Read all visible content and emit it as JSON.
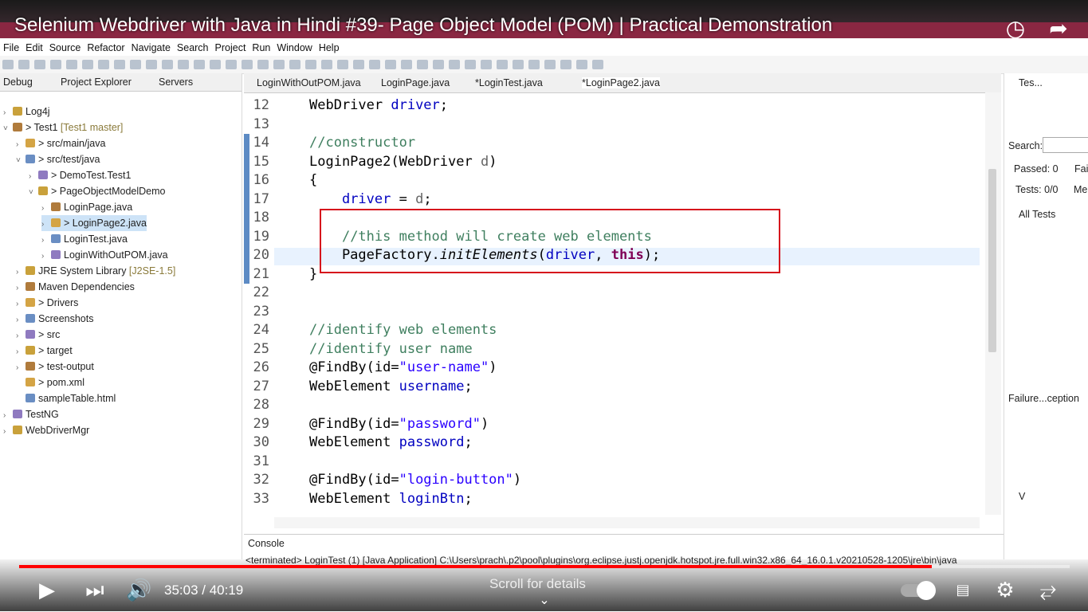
{
  "video": {
    "title": "Selenium Webdriver with Java in Hindi #39- Page Object Model (POM) | Practical Demonstration",
    "time": "35:03 / 40:19",
    "progress": 0.869,
    "scroll_hint": "Scroll for details"
  },
  "menu": [
    "File",
    "Edit",
    "Source",
    "Refactor",
    "Navigate",
    "Search",
    "Project",
    "Run",
    "Window",
    "Help"
  ],
  "left_tabs": {
    "debug": "Debug",
    "project_explorer": "Project Explorer",
    "servers": "Servers"
  },
  "tree": [
    {
      "label": "Log4j",
      "deco": "",
      "indent": 0,
      "arrow": ">"
    },
    {
      "label": "> Test1",
      "deco": "[Test1 master]",
      "indent": 0,
      "arrow": "v"
    },
    {
      "label": "> src/main/java",
      "deco": "",
      "indent": 1,
      "arrow": ">"
    },
    {
      "label": "> src/test/java",
      "deco": "",
      "indent": 1,
      "arrow": "v"
    },
    {
      "label": "> DemoTest.Test1",
      "deco": "",
      "indent": 2,
      "arrow": ">"
    },
    {
      "label": "> PageObjectModelDemo",
      "deco": "",
      "indent": 2,
      "arrow": "v"
    },
    {
      "label": "LoginPage.java",
      "deco": "",
      "indent": 3,
      "arrow": ">"
    },
    {
      "label": "> LoginPage2.java",
      "deco": "",
      "indent": 3,
      "arrow": ">",
      "selected": true
    },
    {
      "label": "LoginTest.java",
      "deco": "",
      "indent": 3,
      "arrow": ">"
    },
    {
      "label": "LoginWithOutPOM.java",
      "deco": "",
      "indent": 3,
      "arrow": ">"
    },
    {
      "label": "JRE System Library",
      "deco": "[J2SE-1.5]",
      "indent": 1,
      "arrow": ">"
    },
    {
      "label": "Maven Dependencies",
      "deco": "",
      "indent": 1,
      "arrow": ">"
    },
    {
      "label": "> Drivers",
      "deco": "",
      "indent": 1,
      "arrow": ">"
    },
    {
      "label": "Screenshots",
      "deco": "",
      "indent": 1,
      "arrow": ">"
    },
    {
      "label": "> src",
      "deco": "",
      "indent": 1,
      "arrow": ">"
    },
    {
      "label": "> target",
      "deco": "",
      "indent": 1,
      "arrow": ">"
    },
    {
      "label": "> test-output",
      "deco": "",
      "indent": 1,
      "arrow": ">"
    },
    {
      "label": "> pom.xml",
      "deco": "",
      "indent": 1,
      "arrow": ""
    },
    {
      "label": "sampleTable.html",
      "deco": "",
      "indent": 1,
      "arrow": ""
    },
    {
      "label": "TestNG",
      "deco": "",
      "indent": 0,
      "arrow": ">"
    },
    {
      "label": "WebDriverMgr",
      "deco": "",
      "indent": 0,
      "arrow": ">"
    }
  ],
  "editor_tabs": [
    "LoginWithOutPOM.java",
    "LoginPage.java",
    "*LoginTest.java",
    "*LoginPage2.java"
  ],
  "code": [
    {
      "n": "12",
      "parts": [
        [
          "WebDriver ",
          ""
        ],
        [
          "driver",
          "fld"
        ],
        [
          ";",
          ""
        ]
      ]
    },
    {
      "n": "13",
      "parts": []
    },
    {
      "n": "14",
      "parts": [
        [
          "//constructor",
          "cm"
        ]
      ]
    },
    {
      "n": "15",
      "parts": [
        [
          "LoginPage2(WebDriver ",
          ""
        ],
        [
          "d",
          "ann"
        ],
        [
          ")",
          ""
        ]
      ]
    },
    {
      "n": "16",
      "parts": [
        [
          "{",
          ""
        ]
      ]
    },
    {
      "n": "17",
      "parts": [
        [
          "    ",
          ""
        ],
        [
          "driver",
          "fld"
        ],
        [
          " = ",
          ""
        ],
        [
          "d",
          "ann"
        ],
        [
          ";",
          ""
        ]
      ]
    },
    {
      "n": "18",
      "parts": []
    },
    {
      "n": "19",
      "parts": [
        [
          "    ",
          ""
        ],
        [
          "//this method will create web elements",
          "cm"
        ]
      ]
    },
    {
      "n": "20",
      "parts": [
        [
          "    PageFactory.",
          ""
        ],
        [
          "initElements",
          "it"
        ],
        [
          "(",
          ""
        ],
        [
          "driver",
          "fld"
        ],
        [
          ", ",
          ""
        ],
        [
          "this",
          "kw"
        ],
        [
          ");",
          ""
        ]
      ]
    },
    {
      "n": "21",
      "parts": [
        [
          "}",
          ""
        ]
      ]
    },
    {
      "n": "22",
      "parts": []
    },
    {
      "n": "23",
      "parts": []
    },
    {
      "n": "24",
      "parts": [
        [
          "//identify web elements",
          "cm"
        ]
      ]
    },
    {
      "n": "25",
      "parts": [
        [
          "//identify user name",
          "cm"
        ]
      ]
    },
    {
      "n": "26",
      "parts": [
        [
          "@FindBy(id=",
          ""
        ],
        [
          "\"user-name\"",
          "str"
        ],
        [
          ")",
          ""
        ]
      ]
    },
    {
      "n": "27",
      "parts": [
        [
          "WebElement ",
          ""
        ],
        [
          "username",
          "fld"
        ],
        [
          ";",
          ""
        ]
      ]
    },
    {
      "n": "28",
      "parts": []
    },
    {
      "n": "29",
      "parts": [
        [
          "@FindBy(id=",
          ""
        ],
        [
          "\"password\"",
          "str"
        ],
        [
          ")",
          ""
        ]
      ]
    },
    {
      "n": "30",
      "parts": [
        [
          "WebElement ",
          ""
        ],
        [
          "password",
          "fld"
        ],
        [
          ";",
          ""
        ]
      ]
    },
    {
      "n": "31",
      "parts": []
    },
    {
      "n": "32",
      "parts": [
        [
          "@FindBy(id=",
          ""
        ],
        [
          "\"login-button\"",
          "str"
        ],
        [
          ")",
          ""
        ]
      ]
    },
    {
      "n": "33",
      "parts": [
        [
          "WebElement ",
          ""
        ],
        [
          "loginBtn",
          "fld"
        ],
        [
          ";",
          ""
        ]
      ]
    }
  ],
  "console": {
    "tab": "Console",
    "status": "<terminated> LoginTest (1) [Java Application] C:\\Users\\prach\\.p2\\pool\\plugins\\org.eclipse.justj.openjdk.hotspot.jre.full.win32.x86_64_16.0.1.v20210528-1205\\jre\\bin\\java"
  },
  "right_panel": {
    "tab": "Tes...",
    "search_label": "Search:",
    "passed": "Passed: 0",
    "failed": "Fail",
    "tests": "Tests: 0/0",
    "tests_more": "Me",
    "all_tests": "All Tests",
    "failure": "Failure...ception",
    "view_tab": "V"
  }
}
